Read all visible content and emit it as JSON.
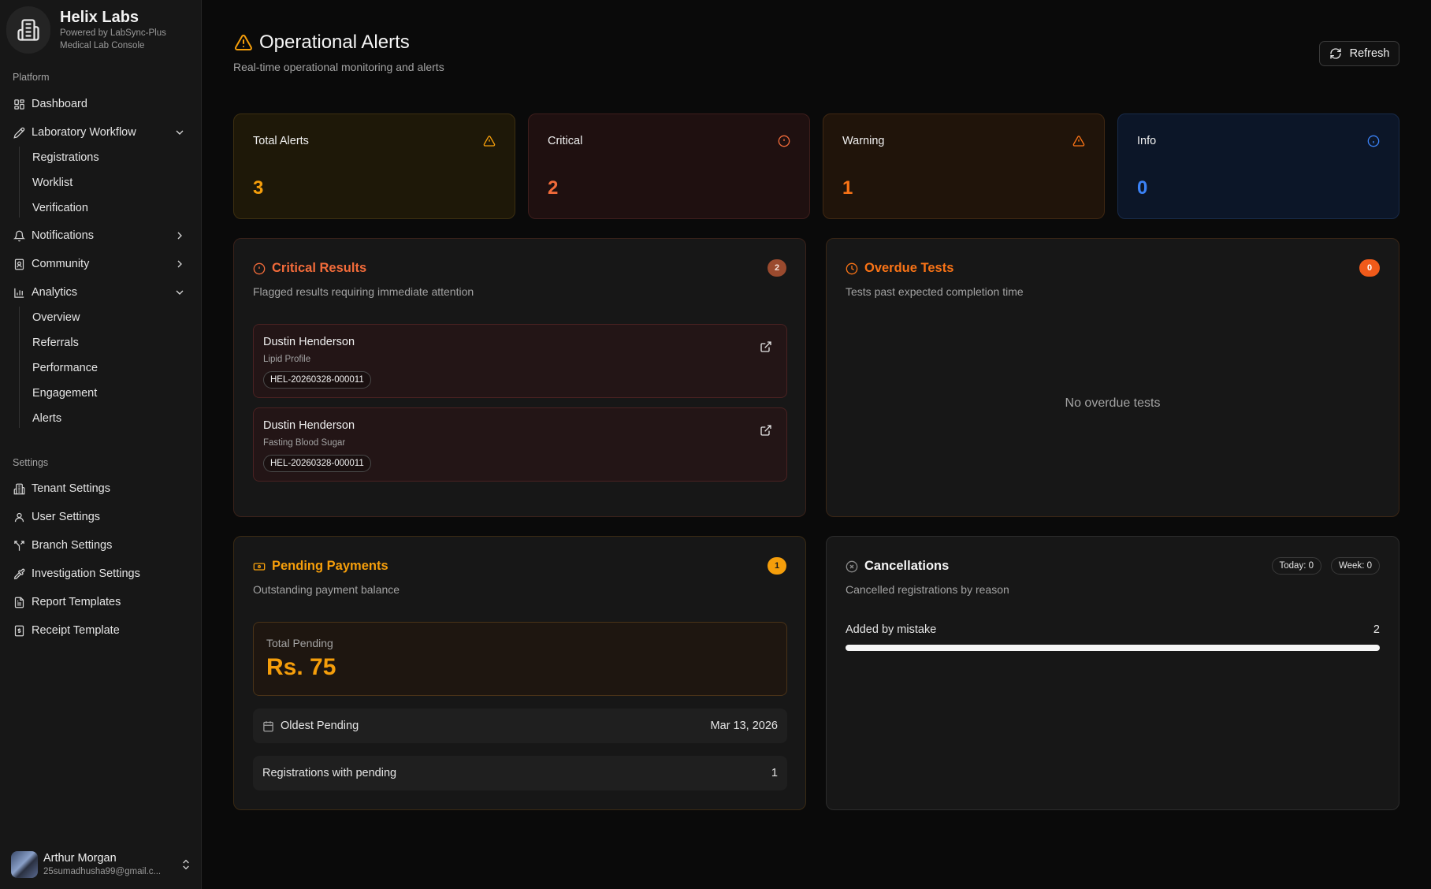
{
  "brand": {
    "name": "Helix Labs",
    "powered_by": "Powered by LabSync-Plus",
    "console": "Medical Lab Console"
  },
  "sidebar": {
    "platform_label": "Platform",
    "items": [
      {
        "label": "Dashboard",
        "icon": "dashboard-icon"
      },
      {
        "label": "Laboratory Workflow",
        "icon": "pencil-icon",
        "expanded": true,
        "children": [
          "Registrations",
          "Worklist",
          "Verification"
        ]
      },
      {
        "label": "Notifications",
        "icon": "bell-icon",
        "expanded": false
      },
      {
        "label": "Community",
        "icon": "contacts-icon",
        "expanded": false
      },
      {
        "label": "Analytics",
        "icon": "bar-chart-icon",
        "expanded": true,
        "children": [
          "Overview",
          "Referrals",
          "Performance",
          "Engagement",
          "Alerts"
        ]
      }
    ],
    "settings_label": "Settings",
    "settings_items": [
      {
        "label": "Tenant Settings",
        "icon": "building-icon"
      },
      {
        "label": "User Settings",
        "icon": "user-icon"
      },
      {
        "label": "Branch Settings",
        "icon": "branch-icon"
      },
      {
        "label": "Investigation Settings",
        "icon": "pipette-icon"
      },
      {
        "label": "Report Templates",
        "icon": "document-icon"
      },
      {
        "label": "Receipt Template",
        "icon": "receipt-icon"
      }
    ],
    "user": {
      "name": "Arthur Morgan",
      "email": "25sumadhusha99@gmail.c..."
    }
  },
  "header": {
    "title": "Operational Alerts",
    "subtitle": "Real-time operational monitoring and alerts",
    "refresh_label": "Refresh"
  },
  "stats": [
    {
      "label": "Total Alerts",
      "value": "3",
      "color": "#f59e0b"
    },
    {
      "label": "Critical",
      "value": "2",
      "color": "#f26b3a"
    },
    {
      "label": "Warning",
      "value": "1",
      "color": "#f97316"
    },
    {
      "label": "Info",
      "value": "0",
      "color": "#3b82f6"
    }
  ],
  "critical_results": {
    "title": "Critical Results",
    "description": "Flagged results requiring immediate attention",
    "count": "2",
    "items": [
      {
        "name": "Dustin Henderson",
        "test": "Lipid Profile",
        "id": "HEL-20260328-000011"
      },
      {
        "name": "Dustin Henderson",
        "test": "Fasting Blood Sugar",
        "id": "HEL-20260328-000011"
      }
    ]
  },
  "overdue_tests": {
    "title": "Overdue Tests",
    "description": "Tests past expected completion time",
    "count": "0",
    "empty": "No overdue tests"
  },
  "pending_payments": {
    "title": "Pending Payments",
    "description": "Outstanding payment balance",
    "count": "1",
    "total_label": "Total Pending",
    "total_value": "Rs. 75",
    "oldest_label": "Oldest Pending",
    "oldest_value": "Mar 13, 2026",
    "registrations_label": "Registrations with pending",
    "registrations_value": "1"
  },
  "cancellations": {
    "title": "Cancellations",
    "description": "Cancelled registrations by reason",
    "today": "Today: 0",
    "week": "Week: 0",
    "reasons": [
      {
        "label": "Added by mistake",
        "value": "2",
        "fraction": 1.0
      }
    ]
  }
}
